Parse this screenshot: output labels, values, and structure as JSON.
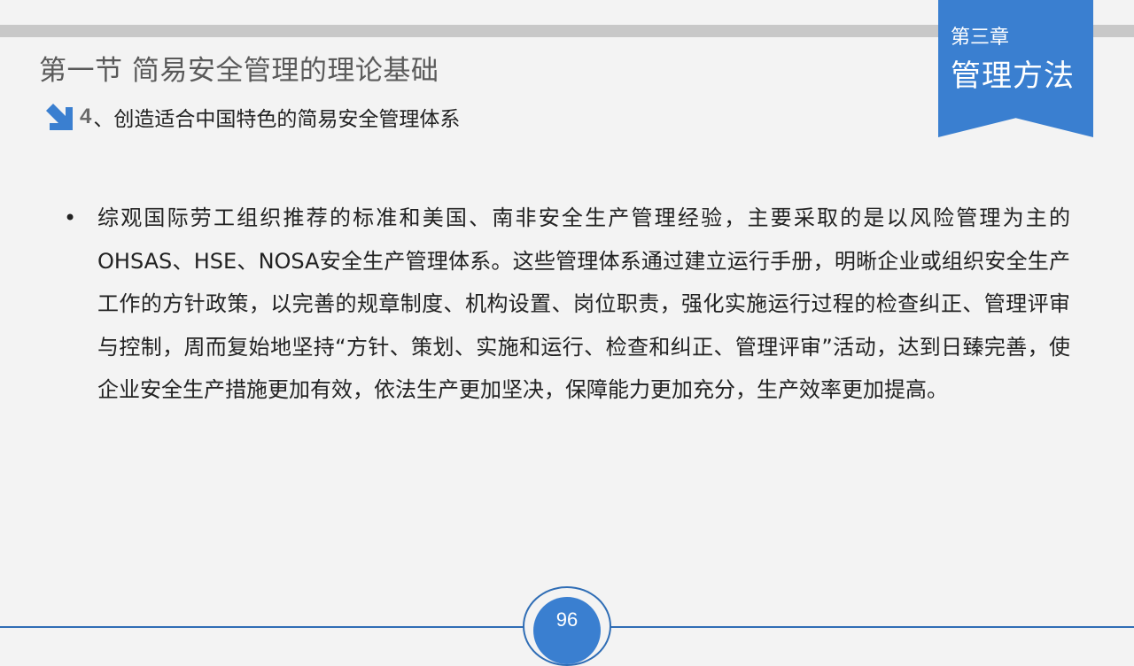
{
  "header": {
    "section_title": "第一节  简易安全管理的理论基础",
    "subheading_number": "4",
    "subheading_text": "、创造适合中国特色的简易安全管理体系"
  },
  "chapter_badge": {
    "label_small": "第三章",
    "label_big": "管理方法",
    "color": "#3a7fd0"
  },
  "content": {
    "bullet_symbol": "•",
    "paragraph": "综观国际劳工组织推荐的标准和美国、南非安全生产管理经验，主要采取的是以风险管理为主的OHSAS、HSE、NOSA安全生产管理体系。这些管理体系通过建立运行手册，明晰企业或组织安全生产工作的方针政策，以完善的规章制度、机构设置、岗位职责，强化实施运行过程的检查纠正、管理评审与控制，周而复始地坚持“方针、策划、实施和运行、检查和纠正、管理评审”活动，达到日臻完善，使企业安全生产措施更加有效，依法生产更加坚决，保障能力更加充分，生产效率更加提高。"
  },
  "footer": {
    "page_number": "96",
    "accent_color": "#2f6db5"
  },
  "icons": {
    "subheading_icon": "arrow-down-right-icon"
  }
}
